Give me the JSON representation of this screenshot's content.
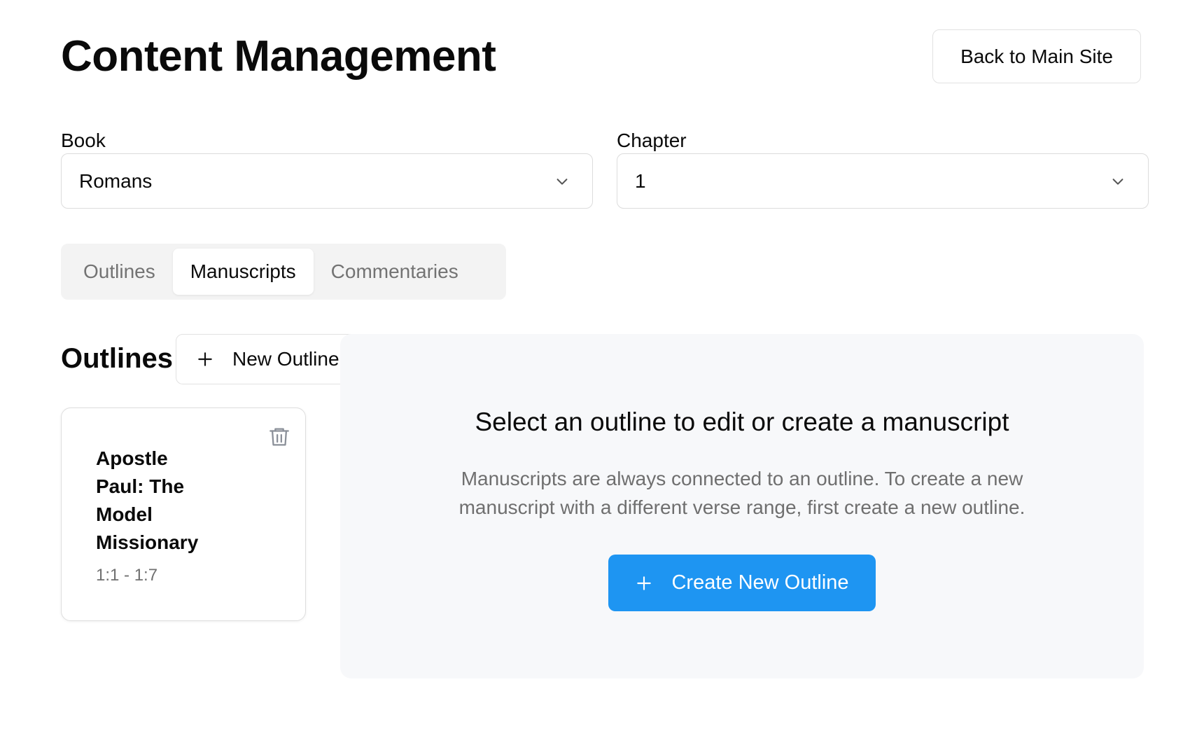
{
  "header": {
    "title": "Content Management",
    "back_button_label": "Back to Main Site"
  },
  "filters": {
    "book": {
      "label": "Book",
      "selected": "Romans"
    },
    "chapter": {
      "label": "Chapter",
      "selected": "1"
    }
  },
  "tabs": [
    {
      "label": "Outlines",
      "active": false
    },
    {
      "label": "Manuscripts",
      "active": true
    },
    {
      "label": "Commentaries",
      "active": false
    }
  ],
  "outlines_section": {
    "title": "Outlines",
    "new_button_label": "New Outline",
    "items": [
      {
        "title": "Apostle Paul: The Model Missionary",
        "range": "1:1 - 1:7"
      }
    ]
  },
  "empty_state": {
    "title": "Select an outline to edit or create a manuscript",
    "description": "Manuscripts are always connected to an outline. To create a new manuscript with a different verse range, first create a new outline.",
    "button_label": "Create New Outline"
  },
  "icons": {
    "chevron": "chevron-down-icon",
    "plus": "plus-icon",
    "trash": "trash-icon"
  },
  "colors": {
    "primary": "#1e95f2",
    "muted_text": "#737373",
    "tab_bar_bg": "#f3f3f3",
    "panel_bg": "#f7f8fa"
  }
}
